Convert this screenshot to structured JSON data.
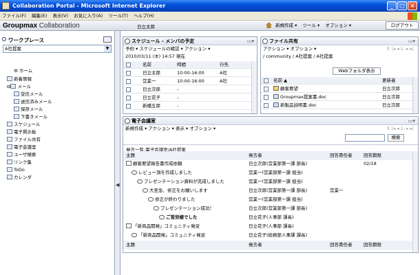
{
  "window": {
    "title": "Collaboration Portal - Microsoft Internet Explorer",
    "min": "_",
    "max": "□",
    "close": "×"
  },
  "menu": [
    "ファイル(F)",
    "編集(E)",
    "表示(V)",
    "お気に入り(A)",
    "ツール(T)",
    "ヘルプ(H)"
  ],
  "header": {
    "logo_bold": "Groupmax",
    "logo_rest": " Collaboration",
    "user": "日立太郎",
    "menus": [
      "新規作成 ▾",
      "ツール ▾",
      "オプション ▾"
    ],
    "logout": "ログアウト"
  },
  "left": {
    "title": "ワークプレース",
    "workplace": "A社提案",
    "home": "ホーム",
    "tree": [
      "新着情報",
      "メール",
      "受信メール",
      "送信済みメール",
      "保存メール",
      "下書きメール",
      "スケジュール",
      "電子掲示板",
      "ファイル共有",
      "電子会議室",
      "ユーザ検索",
      "リンク集",
      "ToDo",
      "カレンダ"
    ]
  },
  "schedule": {
    "title": "スケジュール - メンバの予定",
    "toolbar": "予約 ▾ スケジュールの確認 ▾ アクション ▾",
    "datetime": "2010/03/11 (木) 14:57 現在",
    "col_name": "名前",
    "col_time": "時間",
    "col_place": "行先",
    "rows": [
      {
        "name": "日立太郎",
        "time": "10:00-16:00",
        "place": "A社"
      },
      {
        "name": "営業一",
        "time": "10:00-16:00",
        "place": "A社"
      },
      {
        "name": "日立次郎",
        "time": "-",
        "place": ""
      },
      {
        "name": "日立花子",
        "time": "-",
        "place": ""
      },
      {
        "name": "新橋五郎",
        "time": "-",
        "place": ""
      }
    ]
  },
  "files": {
    "title": "ファイル共有",
    "toolbar": "アクション ▾ オプション ▾",
    "nav": "⇕ |◂ ◂ 1- ▸ ▸|",
    "path": "/ community / A社提案 / A社提案",
    "webfolder": "Webフォルダ表示",
    "col_name": "名前 ▲",
    "col_updater": "更新者",
    "rows": [
      {
        "name": "顧客要望",
        "updater": "日立次郎"
      },
      {
        "name": "Groupmax提案書.doc",
        "updater": "日立次郎"
      },
      {
        "name": "新製品説明書.doc",
        "updater": "日立次郎"
      }
    ]
  },
  "meeting": {
    "title": "電子会議室",
    "toolbar": "新規作成 ▾ アクション ▾ 表示 ▾ オプション ▾",
    "nav": "⇕ |◂ ◂ 1- ▸ ▸|",
    "search_btn": "検索",
    "breadcrumb": "発言一覧:電子会議室/A社提案",
    "col_subject": "主題",
    "col_speaker": "発言者",
    "col_resp": "回答責任者",
    "col_due": "回答期限",
    "rows": [
      {
        "subject": "顧客要望報告書作成依頼",
        "speaker": "日立次郎(営業部第一課 部長)",
        "resp": "",
        "due": "02/18"
      },
      {
        "subject": "レビュー頂を作成しました",
        "speaker": "営業一(営業部第一課 担当)",
        "resp": "",
        "due": ""
      },
      {
        "subject": "プレゼンテーション資料が完成しました",
        "speaker": "営業一(営業部第一課 担当)",
        "resp": "",
        "due": ""
      },
      {
        "subject": "大至急、修正をお願いします",
        "speaker": "日立次郎(営業部第一課 部長)",
        "resp": "営業一",
        "due": ""
      },
      {
        "subject": "修正が終わりました",
        "speaker": "営業一(営業部第一課 担当)",
        "resp": "",
        "due": ""
      },
      {
        "subject": "プレゼンテーション成功！",
        "speaker": "日立次郎(営業部第一課 部長)",
        "resp": "",
        "due": ""
      },
      {
        "subject": "ご苦労様でした",
        "speaker": "日立花子(人事部 課長)",
        "resp": "",
        "due": ""
      },
      {
        "subject": "「新商品開発」コミュニティ発足",
        "speaker": "日立花子(人事部 課長)",
        "resp": "",
        "due": ""
      },
      {
        "subject": "「新商品開発」コミュニティ発足",
        "speaker": "日立花子(総務部人事課 課長)",
        "resp": "",
        "due": ""
      }
    ]
  }
}
